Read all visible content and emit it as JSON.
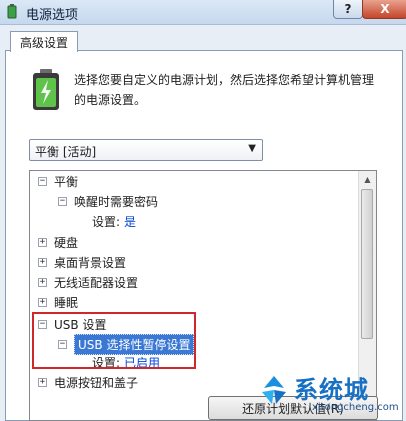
{
  "window": {
    "title": "电源选项",
    "help_label": "?",
    "close_label": "X"
  },
  "tab": {
    "label": "高级设置"
  },
  "description": "选择您要自定义的电源计划，然后选择您希望计算机管理的电源设置。",
  "plan_select": {
    "value": "平衡 [活动]"
  },
  "tree": {
    "items": [
      {
        "expander": "−",
        "label": "平衡"
      },
      {
        "expander": "−",
        "label": "唤醒时需要密码"
      },
      {
        "label": "设置:",
        "value": "是"
      },
      {
        "expander": "+",
        "label": "硬盘"
      },
      {
        "expander": "+",
        "label": "桌面背景设置"
      },
      {
        "expander": "+",
        "label": "无线适配器设置"
      },
      {
        "expander": "+",
        "label": "睡眠"
      },
      {
        "expander": "−",
        "label": "USB 设置"
      },
      {
        "expander": "−",
        "label": "USB 选择性暂停设置"
      },
      {
        "label": "设置:",
        "value": "已启用"
      },
      {
        "expander": "+",
        "label": "电源按钮和盖子"
      }
    ]
  },
  "buttons": {
    "restore_label": "还原计划默认值(R)"
  },
  "watermark": {
    "brand": "系统城",
    "url": "xitongcheng.com"
  },
  "colors": {
    "highlight_border": "#d0272c",
    "selection": "#3a78d4",
    "link": "#0046d5"
  }
}
